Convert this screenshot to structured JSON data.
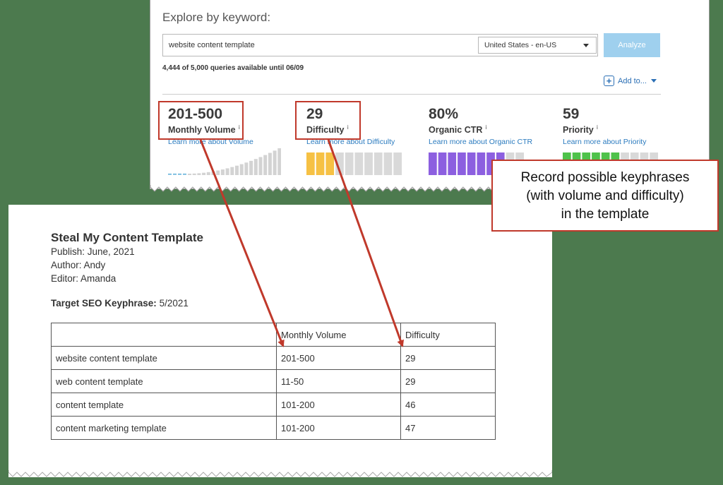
{
  "explore": {
    "title": "Explore by keyword:",
    "search_value": "website content template",
    "locale": "United States - en-US",
    "analyze_label": "Analyze",
    "quota_text": "4,444 of 5,000 queries available until 06/09",
    "add_to_label": "Add to..."
  },
  "metrics": [
    {
      "value": "201-500",
      "label": "Monthly Volume",
      "info": "i",
      "link": "Learn more about Volume"
    },
    {
      "value": "29",
      "label": "Difficulty",
      "info": "i",
      "link": "Learn more about Difficulty",
      "level": 0.29
    },
    {
      "value": "80%",
      "label": "Organic CTR",
      "info": "i",
      "link": "Learn more about Organic CTR",
      "level": 0.8
    },
    {
      "value": "59",
      "label": "Priority",
      "info": "i",
      "link": "Learn more about Priority",
      "level": 0.59
    }
  ],
  "colors": {
    "highlight": "#c0392b",
    "volume_bar": "#d3d3d3",
    "volume_dash": "#5aaed8",
    "difficulty_bar": "#f6c144",
    "ctr_bar": "#8c5fe0",
    "priority_bar": "#4ec24a",
    "empty_bar": "#d9d9d9"
  },
  "callout": {
    "line1": "Record possible keyphrases",
    "line2": "(with volume and difficulty)",
    "line3": "in the template"
  },
  "doc": {
    "title": "Steal My Content Template",
    "publish": "Publish: June, 2021",
    "author": "Author: Andy",
    "editor": "Editor: Amanda",
    "keyphrase_label": "Target SEO Keyphrase:",
    "keyphrase_value": " 5/2021",
    "table_headers": [
      "",
      "Monthly Volume",
      "Difficulty"
    ],
    "table_rows": [
      [
        "website content template",
        "201-500",
        "29"
      ],
      [
        "web content template",
        "11-50",
        "29"
      ],
      [
        "content template",
        "101-200",
        "46"
      ],
      [
        "content marketing template",
        "101-200",
        "47"
      ]
    ]
  }
}
